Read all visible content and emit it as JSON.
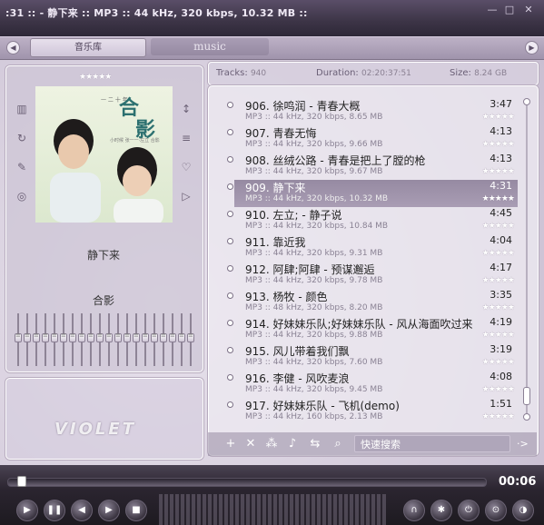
{
  "window": {
    "title": ":31 :: - 静下来 :: MP3 :: 44 kHz, 320 kbps, 10.32 MB :: ",
    "minimize": "—",
    "maximize": "□",
    "close": "✕"
  },
  "tabs": [
    {
      "label": "音乐库",
      "active": true
    },
    {
      "label": "music",
      "active": false
    }
  ],
  "library_info": {
    "tracks_label": "Tracks:",
    "tracks_value": "940",
    "duration_label": "Duration:",
    "duration_value": "02:20:37:51",
    "size_label": "Size:",
    "size_value": "8.24 GB"
  },
  "now_playing": {
    "title": "静下来",
    "album": "合影",
    "rating_stars": "★★★★★",
    "cover": {
      "title_a": "合",
      "title_b": "影",
      "top_text": "一 二 十 年",
      "bottom_text": "小时候 张一一·左立 合影"
    }
  },
  "eq_bands": 20,
  "logo": "VIOLET",
  "playlist": [
    {
      "name": "906. 徐鸣润 - 青春大概",
      "duration": "3:47",
      "meta": "MP3 :: 44 kHz, 320 kbps, 8.65 MB",
      "selected": false
    },
    {
      "name": "907. 青春无悔",
      "duration": "4:13",
      "meta": "MP3 :: 44 kHz, 320 kbps, 9.66 MB",
      "selected": false
    },
    {
      "name": "908. 丝绒公路 - 青春是把上了膛的枪",
      "duration": "4:13",
      "meta": "MP3 :: 44 kHz, 320 kbps, 9.67 MB",
      "selected": false
    },
    {
      "name": "909. 静下来",
      "duration": "4:31",
      "meta": "MP3 :: 44 kHz, 320 kbps, 10.32 MB",
      "selected": true
    },
    {
      "name": "910. 左立; - 静子说",
      "duration": "4:45",
      "meta": "MP3 :: 44 kHz, 320 kbps, 10.84 MB",
      "selected": false
    },
    {
      "name": "911. 靠近我",
      "duration": "4:04",
      "meta": "MP3 :: 44 kHz, 320 kbps, 9.31 MB",
      "selected": false
    },
    {
      "name": "912. 阿肆;阿肆 - 预谋邂逅",
      "duration": "4:17",
      "meta": "MP3 :: 44 kHz, 320 kbps, 9.78 MB",
      "selected": false
    },
    {
      "name": "913. 杨牧 - 颜色",
      "duration": "3:35",
      "meta": "MP3 :: 48 kHz, 320 kbps, 8.20 MB",
      "selected": false
    },
    {
      "name": "914. 好妹妹乐队;好妹妹乐队 - 风从海面吹过来",
      "duration": "4:19",
      "meta": "MP3 :: 44 kHz, 320 kbps, 9.88 MB",
      "selected": false
    },
    {
      "name": "915. 风儿带着我们飘",
      "duration": "3:19",
      "meta": "MP3 :: 44 kHz, 320 kbps, 7.60 MB",
      "selected": false
    },
    {
      "name": "916. 李健 - 风吹麦浪",
      "duration": "4:08",
      "meta": "MP3 :: 44 kHz, 320 kbps, 9.45 MB",
      "selected": false
    },
    {
      "name": "917. 好妹妹乐队 - 飞机(demo)",
      "duration": "1:51",
      "meta": "MP3 :: 44 kHz, 160 kbps, 2.13 MB",
      "selected": false
    }
  ],
  "track_stars": "★★★★★",
  "toolbar": {
    "add": "+",
    "remove": "✕",
    "group": "⁂",
    "note": "♪",
    "shuffle": "⇆",
    "search_icon": "⌕",
    "search_placeholder": "快速搜索",
    "go": "·>"
  },
  "player": {
    "time": "00:06",
    "progress_fraction": 0.02
  }
}
